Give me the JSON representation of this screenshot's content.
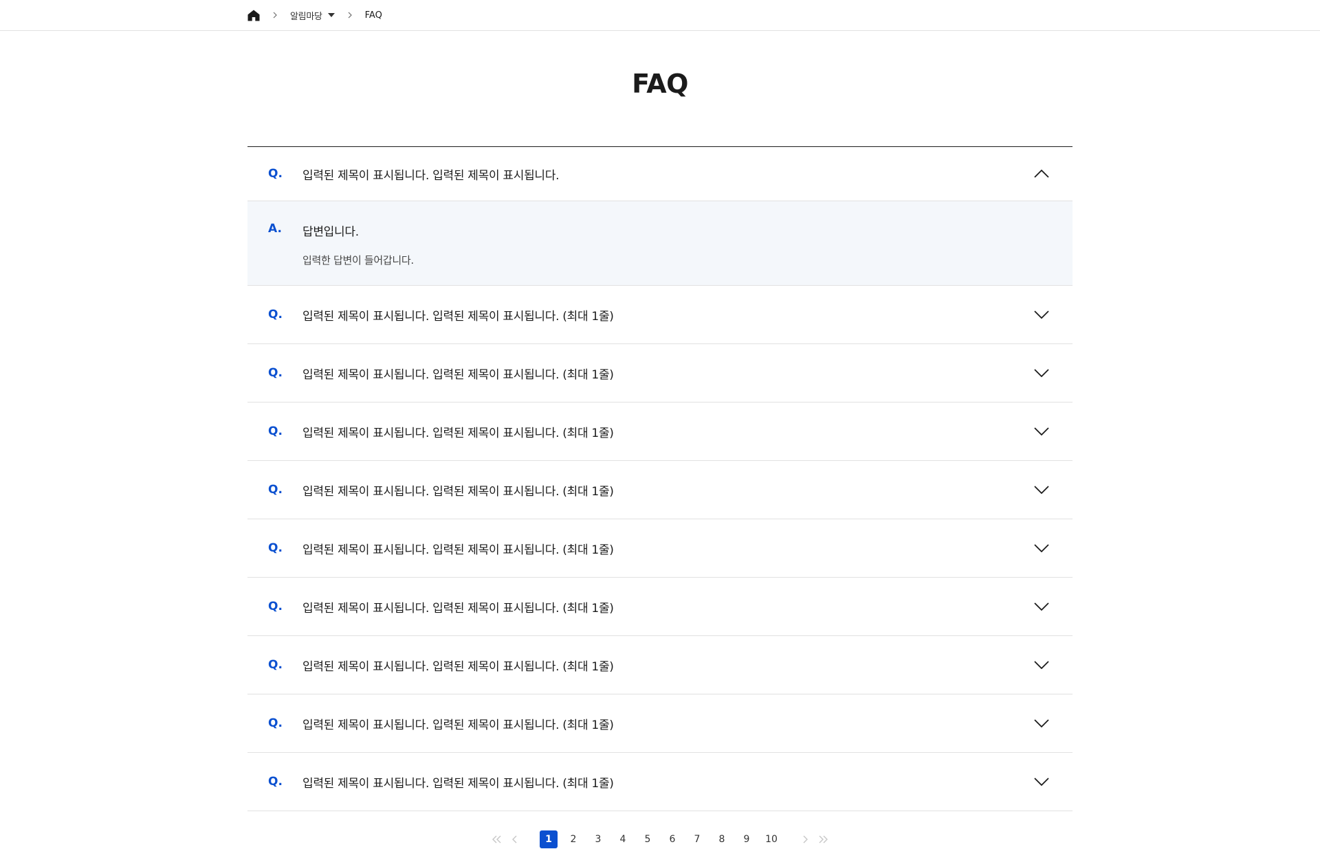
{
  "colors": {
    "accent": "#0b50d0",
    "text": "#1b1b1b",
    "border": "#e1e1e1",
    "answer_bg": "#f4f7fb"
  },
  "breadcrumb": {
    "home_icon": "home-icon",
    "section": "알림마당",
    "current": "FAQ"
  },
  "page": {
    "title": "FAQ"
  },
  "faq": {
    "q_mark": "Q.",
    "a_mark": "A.",
    "items": [
      {
        "question": "입력된 제목이 표시됩니다. 입력된 제목이 표시됩니다.",
        "expanded": true,
        "answer_title": "답변입니다.",
        "answer_text": "입력한 답변이 들어갑니다."
      },
      {
        "question": "입력된 제목이 표시됩니다. 입력된 제목이 표시됩니다. (최대 1줄)",
        "expanded": false
      },
      {
        "question": "입력된 제목이 표시됩니다. 입력된 제목이 표시됩니다. (최대 1줄)",
        "expanded": false
      },
      {
        "question": "입력된 제목이 표시됩니다. 입력된 제목이 표시됩니다. (최대 1줄)",
        "expanded": false
      },
      {
        "question": "입력된 제목이 표시됩니다. 입력된 제목이 표시됩니다. (최대 1줄)",
        "expanded": false
      },
      {
        "question": "입력된 제목이 표시됩니다. 입력된 제목이 표시됩니다. (최대 1줄)",
        "expanded": false
      },
      {
        "question": "입력된 제목이 표시됩니다. 입력된 제목이 표시됩니다. (최대 1줄)",
        "expanded": false
      },
      {
        "question": "입력된 제목이 표시됩니다. 입력된 제목이 표시됩니다. (최대 1줄)",
        "expanded": false
      },
      {
        "question": "입력된 제목이 표시됩니다. 입력된 제목이 표시됩니다. (최대 1줄)",
        "expanded": false
      },
      {
        "question": "입력된 제목이 표시됩니다. 입력된 제목이 표시됩니다. (최대 1줄)",
        "expanded": false
      }
    ]
  },
  "pagination": {
    "pages": [
      "1",
      "2",
      "3",
      "4",
      "5",
      "6",
      "7",
      "8",
      "9",
      "10"
    ],
    "current": "1"
  }
}
